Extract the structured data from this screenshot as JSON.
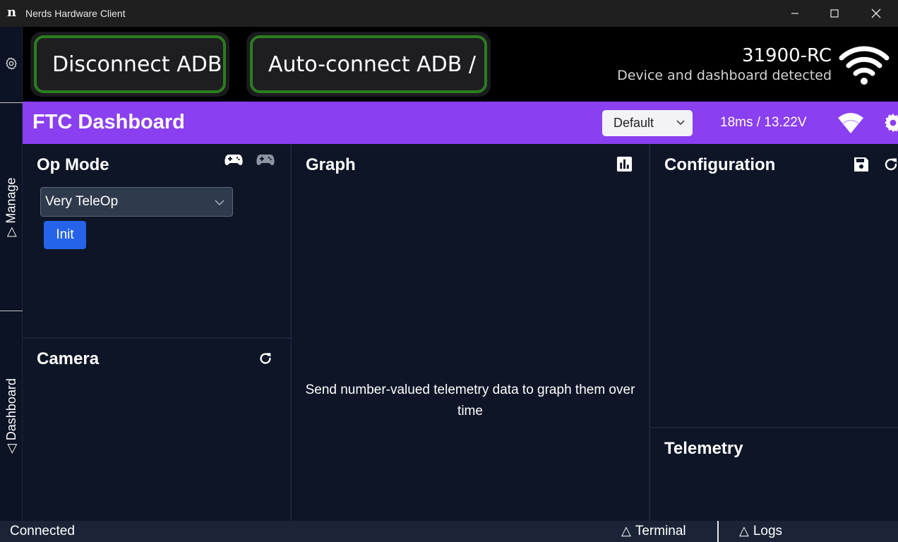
{
  "window": {
    "title": "Nerds Hardware Client",
    "app_icon": "n"
  },
  "sidebar": {
    "tabs": [
      {
        "label": "Manage"
      },
      {
        "label": "Dashboard"
      }
    ],
    "triangle": "▷",
    "triangle2": "◁"
  },
  "topbar": {
    "disconnect_label": "Disconnect ADB",
    "autoconnect_label": "Auto-connect ADB / I",
    "device_name": "31900-RC",
    "device_status": "Device and dashboard detected",
    "accent_green": "#2b7d1e"
  },
  "dashboard": {
    "title": "FTC Dashboard",
    "layout_selected": "Default",
    "latency": "18ms / 13.22V",
    "accent_purple": "#8a3ff0"
  },
  "panels": {
    "opmode": {
      "title": "Op Mode",
      "selected": "Very TeleOp",
      "init_label": "Init"
    },
    "camera": {
      "title": "Camera"
    },
    "graph": {
      "title": "Graph",
      "message": "Send number-valued telemetry data to graph them over time"
    },
    "configuration": {
      "title": "Configuration"
    },
    "telemetry": {
      "title": "Telemetry"
    }
  },
  "statusbar": {
    "connection": "Connected",
    "terminal": "Terminal",
    "logs": "Logs"
  }
}
